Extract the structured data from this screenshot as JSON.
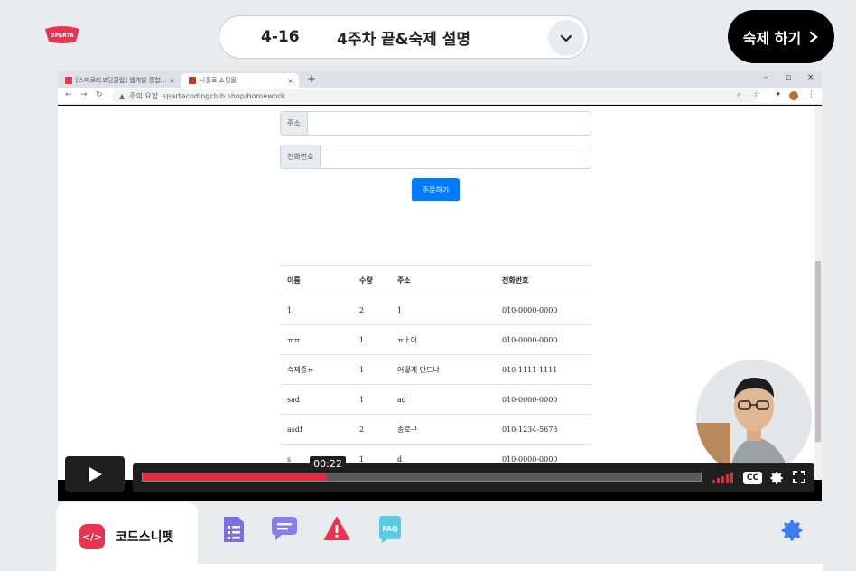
{
  "header": {
    "logo_text": "SPARTA",
    "lesson_number": "4-16",
    "lesson_title": "4주차 끝&숙제 설명",
    "homework_button": "숙제 하기"
  },
  "browser": {
    "tabs": [
      {
        "label": "[스파르타코딩클럽] 웹개발 종합…"
      },
      {
        "label": "나홀로 쇼핑몰"
      }
    ],
    "security_label": "주의 요함",
    "url": "spartacodingclub.shop/homework"
  },
  "form": {
    "address_label": "주소",
    "phone_label": "전화번호",
    "order_button": "주문하기"
  },
  "table": {
    "headers": [
      "이름",
      "수량",
      "주소",
      "전화번호"
    ],
    "rows": [
      [
        "1",
        "2",
        "1",
        "010-0000-0000"
      ],
      [
        "ㅠㅠ",
        "1",
        "ㅠㅏ어",
        "010-0000-0000"
      ],
      [
        "숙제중ㅠ",
        "1",
        "어떻게 만드냐",
        "010-1111-1111"
      ],
      [
        "sad",
        "1",
        "ad",
        "010-0000-0000"
      ],
      [
        "asdf",
        "2",
        "종로구",
        "010-1234-5678"
      ],
      [
        "s",
        "1",
        "d",
        "010-0000-0000"
      ]
    ]
  },
  "player": {
    "time": "00:22",
    "progress_fraction": 0.33,
    "cc_label": "CC",
    "accent_color": "#e02e3c"
  },
  "bottom": {
    "active_tab": "코드스니펫",
    "faq_label": "FAQ"
  }
}
